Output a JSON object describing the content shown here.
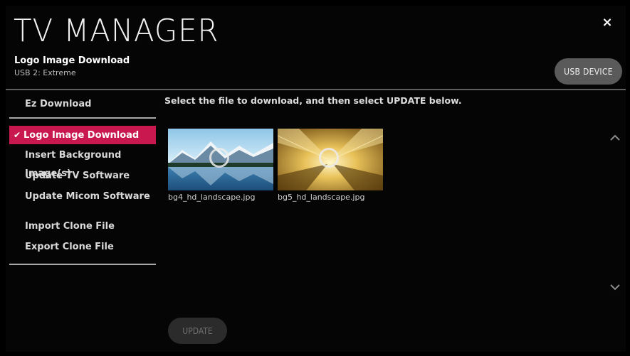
{
  "header": {
    "app_title": "TV MANAGER",
    "page_title": "Logo Image Download",
    "subtitle": "USB 2: Extreme",
    "close_label": "×",
    "usb_button_label": "USB DEVICE"
  },
  "sidebar": {
    "items": [
      {
        "label": "Ez Download",
        "selected": false
      },
      {
        "label": "Logo Image Download",
        "selected": true,
        "check": "✔"
      },
      {
        "label": "Insert Background Image(s)",
        "selected": false
      },
      {
        "label": "Update TV Software",
        "selected": false
      },
      {
        "label": "Update Micom Software",
        "selected": false
      },
      {
        "label": "Import Clone File",
        "selected": false
      },
      {
        "label": "Export Clone File",
        "selected": false
      }
    ]
  },
  "main": {
    "instruction": "Select the file to download, and then select UPDATE below.",
    "files": [
      {
        "name": "bg4_hd_landscape.jpg"
      },
      {
        "name": "bg5_hd_landscape.jpg"
      }
    ],
    "scroll_up_icon": "^",
    "scroll_down_icon": "v",
    "update_label": "UPDATE"
  },
  "colors": {
    "selected_bg": "#c8184f",
    "button_bg": "#5a5a5a",
    "disabled_button_bg": "#2b2b2b"
  }
}
